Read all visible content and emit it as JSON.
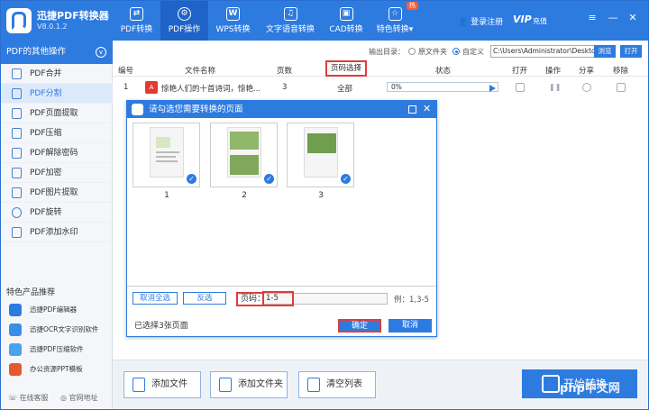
{
  "app": {
    "name": "迅捷PDF转换器",
    "version": "V8.0.1.2"
  },
  "nav": [
    {
      "label": "PDF转换",
      "icon": "convert-icon"
    },
    {
      "label": "PDF操作",
      "icon": "gear-icon"
    },
    {
      "label": "WPS转换",
      "icon": "wps-icon"
    },
    {
      "label": "文字语音转换",
      "icon": "audio-icon"
    },
    {
      "label": "CAD转换",
      "icon": "cad-icon"
    },
    {
      "label": "特色转换▾",
      "icon": "star-icon"
    }
  ],
  "hot_badge": "热",
  "header": {
    "login": "登录注册",
    "vip": "VIP",
    "vip_sub": "充值",
    "menu": "≡",
    "minimize": "—",
    "close": "✕"
  },
  "sidebar": {
    "title": "PDF的其他操作",
    "items": [
      "PDF合并",
      "PDF分割",
      "PDF页面提取",
      "PDF压缩",
      "PDF解除密码",
      "PDF加密",
      "PDF图片提取",
      "PDF旋转",
      "PDF添加水印"
    ],
    "active_index": 1,
    "feature_title": "特色产品推荐",
    "features": [
      "迅捷PDF编辑器",
      "迅捷OCR文字识别软件",
      "迅捷PDF压缩软件",
      "办公资源PPT模板"
    ],
    "online_service": "在线客服",
    "website": "官网地址"
  },
  "output": {
    "label": "输出目录：",
    "option_original": "原文件夹",
    "option_custom": "自定义",
    "path": "C:\\Users\\Administrator\\Deskto",
    "browse": "浏览",
    "open": "打开"
  },
  "table": {
    "headers": [
      "编号",
      "文件名称",
      "页数",
      "页码选择",
      "状态",
      "打开",
      "操作",
      "分享",
      "移除"
    ],
    "rows": [
      {
        "index": "1",
        "filename": "惊艳人们的十首诗词，惊艳...",
        "pages": "3",
        "page_selection": "全部",
        "progress": "0%"
      }
    ]
  },
  "dialog": {
    "title": "请勾选您需要转换的页面",
    "pages": [
      "1",
      "2",
      "3"
    ],
    "deselect_all": "取消全选",
    "invert": "反选",
    "pages_label": "页码：",
    "pages_value": "1-5",
    "example": "例：1,3-5",
    "selected_text": "已选择3张页面",
    "ok": "确定",
    "cancel": "取消"
  },
  "bottom": {
    "add_file": "添加文件",
    "add_folder": "添加文件夹",
    "clear_list": "清空列表",
    "start": "开始转换",
    "watermark": "php中文网"
  },
  "colors": {
    "primary": "#2e7be0",
    "highlight": "#e03c3c",
    "pdf_red": "#e23b33"
  }
}
